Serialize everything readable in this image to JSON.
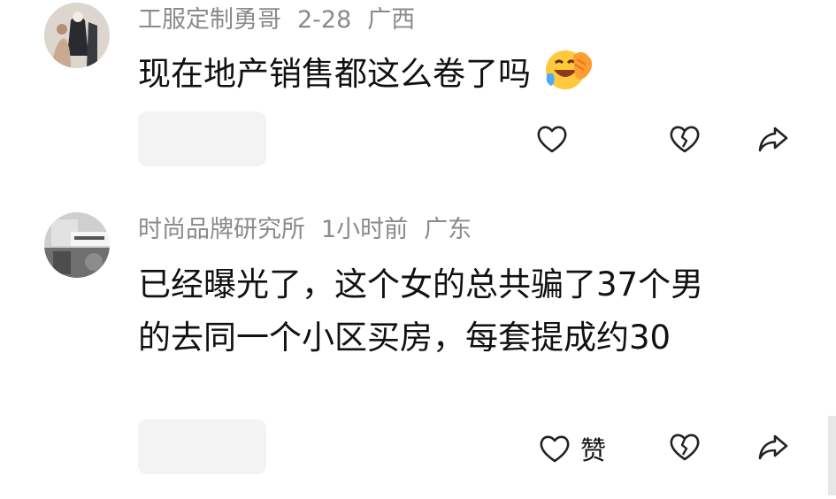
{
  "comments": [
    {
      "author": "工服定制勇哥",
      "date": "2-28",
      "location": "广西",
      "text_lines": [
        "现在地产销售都这么卷了吗"
      ],
      "emoji_icon": "laughing-crying-emoji",
      "like_label": ""
    },
    {
      "author": "时尚品牌研究所",
      "date": "1小时前",
      "location": "广东",
      "text_lines": [
        "已经曝光了，这个女的总共骗了37个男",
        "的去同一个小区买房，每套提成约30"
      ],
      "like_label": "赞"
    }
  ],
  "icons": {
    "like": "heart-outline-icon",
    "dislike": "broken-heart-icon",
    "share": "share-arrow-icon"
  },
  "colors": {
    "meta_text": "#8a8a8a",
    "body_text": "#111111",
    "placeholder": "#f3f3f3"
  }
}
